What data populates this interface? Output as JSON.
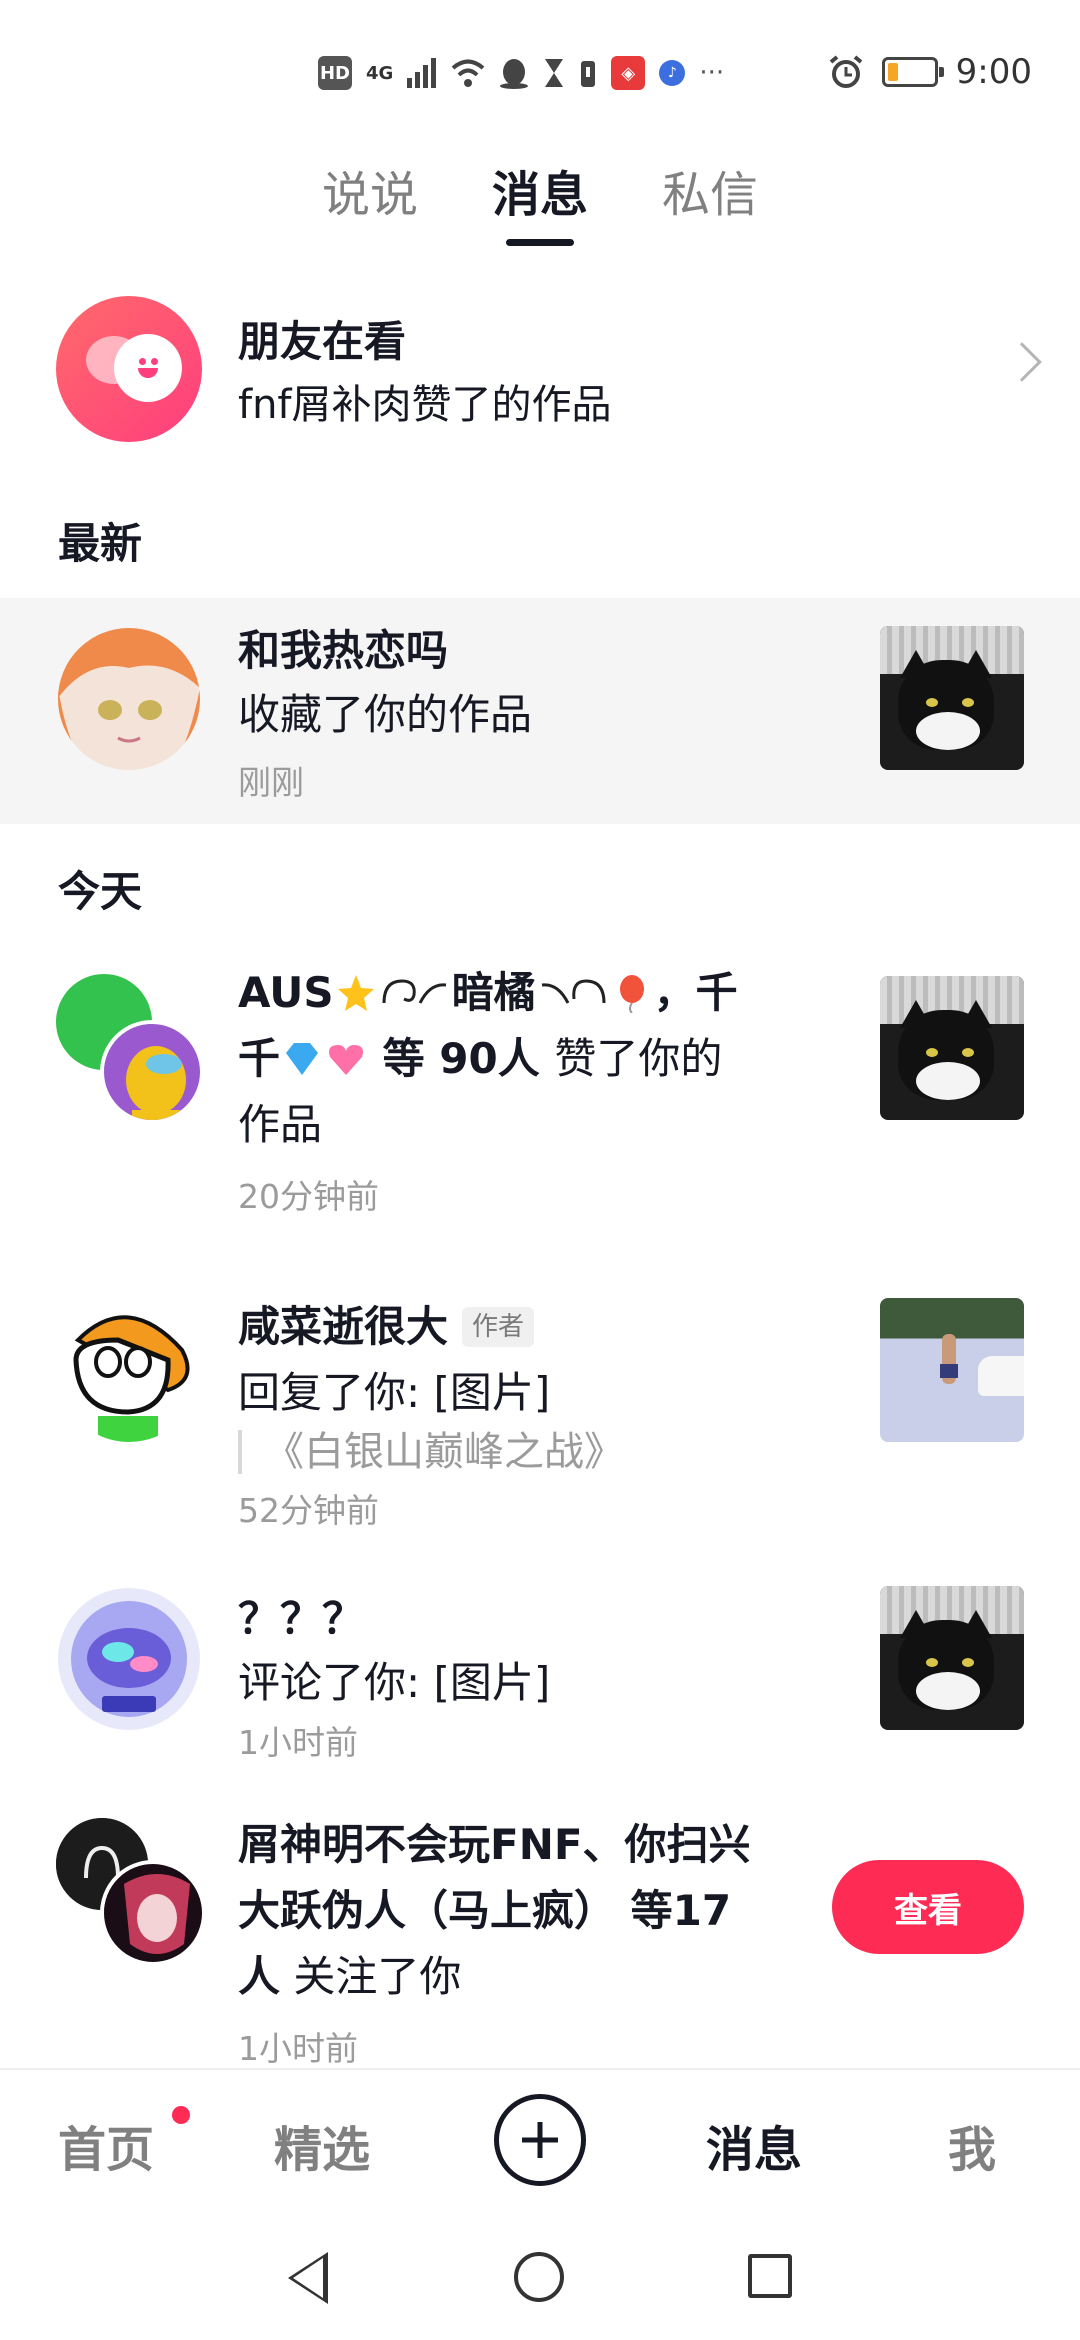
{
  "status_bar": {
    "network": "HD",
    "signal_label": "4G",
    "time": "9:00"
  },
  "tabs": [
    {
      "label": "说说",
      "active": false
    },
    {
      "label": "消息",
      "active": true
    },
    {
      "label": "私信",
      "active": false
    }
  ],
  "friends_watching": {
    "title": "朋友在看",
    "subtitle": "fnf屑补肉赞了的作品"
  },
  "sections": {
    "latest": "最新",
    "today": "今天"
  },
  "latest": {
    "name": "和我热恋吗",
    "action": "收藏了你的作品",
    "time": "刚刚"
  },
  "today": [
    {
      "names_part1": "AUS",
      "names_part2": "暗橘",
      "names_sep": "，千",
      "names_part3": "千",
      "suffix": "等 90人",
      "action_tail": "赞了你的",
      "action_line3": "作品",
      "time": "20分钟前"
    },
    {
      "name": "咸菜逝很大",
      "badge": "作者",
      "action": "回复了你: [图片]",
      "quote": "《白银山巅峰之战》",
      "time": "52分钟前"
    },
    {
      "name": "？？？",
      "action": "评论了你: [图片]",
      "time": "1小时前"
    },
    {
      "names_line1": "屑神明不会玩FNF、你扫兴",
      "names_line2": "大跃伪人（马上疯） 等17",
      "names_line3": "人",
      "action": "关注了你",
      "time": "1小时前",
      "button": "查看"
    }
  ],
  "bottom_nav": [
    {
      "label": "首页",
      "active": false,
      "dot": true
    },
    {
      "label": "精选",
      "active": false
    },
    {
      "label": "消息",
      "active": true
    },
    {
      "label": "我",
      "active": false
    }
  ],
  "colors": {
    "accent": "#fe2c55",
    "text": "#161823",
    "muted": "#9b9b9b"
  }
}
